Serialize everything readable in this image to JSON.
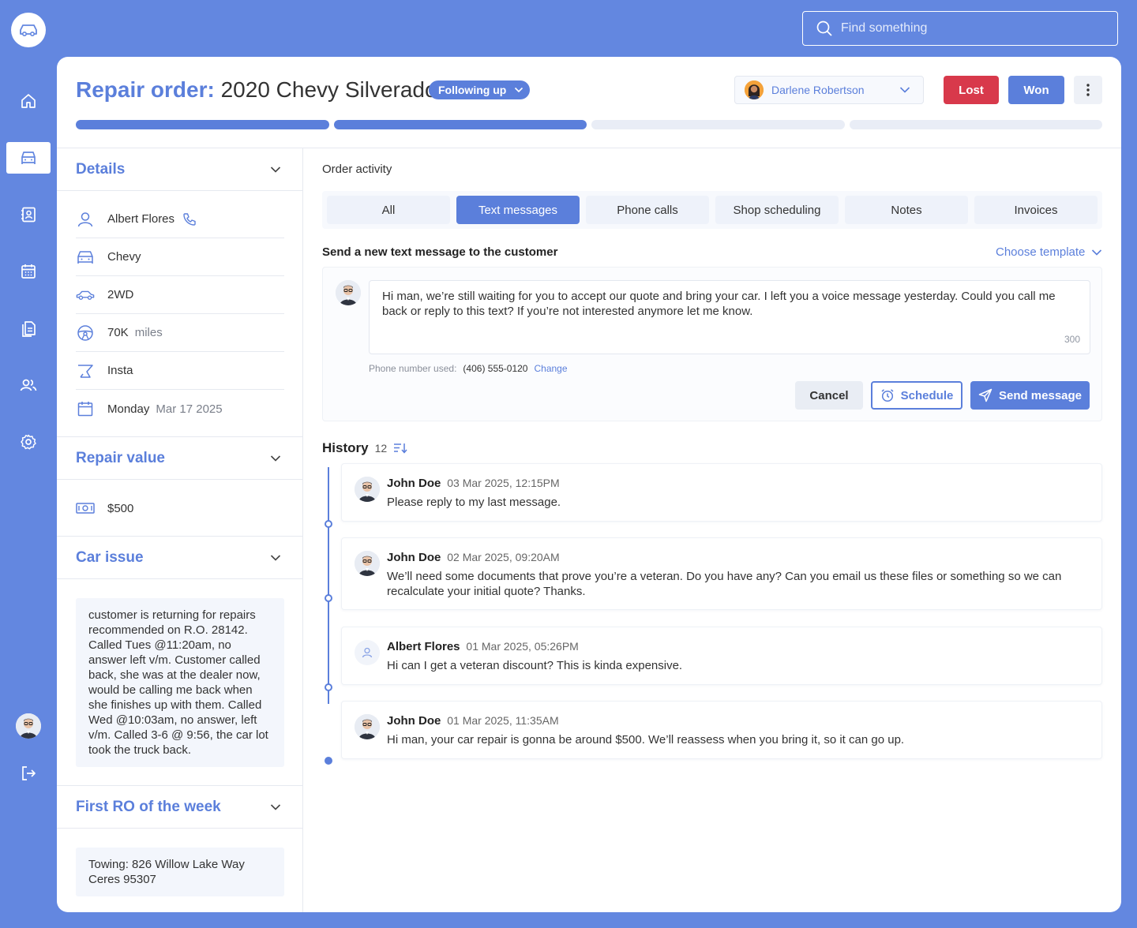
{
  "search": {
    "placeholder": "Find something"
  },
  "header": {
    "title_prefix": "Repair order:",
    "title_vehicle": "2020 Chevy Silverado",
    "status": "Following up",
    "assignee": "Darlene Robertson",
    "lost_label": "Lost",
    "won_label": "Won",
    "progress_steps": [
      true,
      true,
      false,
      false
    ]
  },
  "details": {
    "title": "Details",
    "customer": "Albert Flores",
    "make": "Chevy",
    "drive": "2WD",
    "mileage": "70K",
    "mileage_unit": "miles",
    "source": "Insta",
    "day": "Monday",
    "date": "Mar 17 2025"
  },
  "repair_value": {
    "title": "Repair value",
    "amount": "$500"
  },
  "car_issue": {
    "title": "Car issue",
    "note": "customer is returning for repairs recommended on R.O. 28142. Called Tues @11:20am, no answer left v/m. Customer called back, she was at the dealer now, would be calling me back when she finishes up with them. Called Wed @10:03am, no answer, left v/m. Called 3-6 @ 9:56, the car lot took the truck back."
  },
  "first_ro": {
    "title": "First RO of the week",
    "note": "Towing: 826 Willow Lake Way Ceres 95307"
  },
  "activity": {
    "label": "Order activity",
    "tabs": [
      "All",
      "Text messages",
      "Phone calls",
      "Shop scheduling",
      "Notes",
      "Invoices"
    ],
    "active_tab": "Text messages"
  },
  "compose": {
    "label": "Send a new text message to the customer",
    "template": "Choose template",
    "text": "Hi man, we’re still waiting for you to accept our quote and bring your car. I left you a voice message yesterday. Could you call me back or reply to this text? If you’re not interested anymore let me know.",
    "counter": "300",
    "phone_label": "Phone number used:",
    "phone": "(406) 555-0120",
    "change": "Change",
    "cancel": "Cancel",
    "schedule": "Schedule",
    "send": "Send message"
  },
  "history": {
    "title": "History",
    "count": "12",
    "messages": [
      {
        "author": "John Doe",
        "time": "03 Mar 2025, 12:15PM",
        "text": "Please reply to my last message."
      },
      {
        "author": "John Doe",
        "time": "02 Mar 2025, 09:20AM",
        "text": "We’ll need some documents that prove you’re a veteran. Do you have any? Can you email us these files or something so we can recalculate your initial quote? Thanks."
      },
      {
        "author": "Albert Flores",
        "time": "01 Mar 2025, 05:26PM",
        "text": "Hi can I get a veteran discount? This is kinda expensive."
      },
      {
        "author": "John Doe",
        "time": "01 Mar 2025, 11:35AM",
        "text": "Hi man, your car repair is gonna be around $500. We’ll reassess when you bring it, so it can go up."
      }
    ]
  },
  "colors": {
    "brand": "#6387E0",
    "accent": "#5B7FDB",
    "danger": "#D8394B"
  }
}
